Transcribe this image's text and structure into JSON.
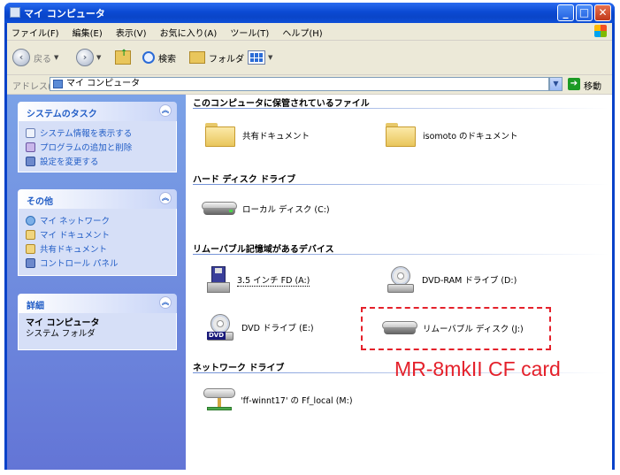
{
  "window": {
    "title": "マイ コンピュータ"
  },
  "menu": [
    "ファイル(F)",
    "編集(E)",
    "表示(V)",
    "お気に入り(A)",
    "ツール(T)",
    "ヘルプ(H)"
  ],
  "toolbar": {
    "back": "戻る",
    "search": "検索",
    "folders": "フォルダ"
  },
  "address": {
    "label": "アドレス(D)",
    "value": "マイ コンピュータ",
    "go": "移動"
  },
  "left": {
    "system_tasks": {
      "title": "システムのタスク",
      "items": [
        "システム情報を表示する",
        "プログラムの追加と削除",
        "設定を変更する"
      ]
    },
    "other": {
      "title": "その他",
      "items": [
        "マイ ネットワーク",
        "マイ ドキュメント",
        "共有ドキュメント",
        "コントロール パネル"
      ]
    },
    "details": {
      "title": "詳細",
      "name": "マイ コンピュータ",
      "type": "システム フォルダ"
    }
  },
  "sections": {
    "files": "このコンピュータに保管されているファイル",
    "hdd": "ハード ディスク ドライブ",
    "removable": "リムーバブル記憶域があるデバイス",
    "network": "ネットワーク ドライブ"
  },
  "items": {
    "shared_docs": "共有ドキュメント",
    "user_docs": "isomoto のドキュメント",
    "local_disk": "ローカル ディスク (C:)",
    "floppy": "3.5 インチ FD (A:)",
    "dvd_ram": "DVD-RAM ドライブ (D:)",
    "dvd": "DVD ドライブ (E:)",
    "removable_disk": "リムーバブル ディスク (J:)",
    "network_drive": "'ff-winnt17' の Ff_local (M:)"
  },
  "annotation": {
    "text": "MR-8mkII CF card",
    "color": "#e4212b"
  },
  "colors": {
    "titlebar": "#0b4ad3",
    "taskpane": "#6375d6",
    "link": "#215dc6"
  }
}
